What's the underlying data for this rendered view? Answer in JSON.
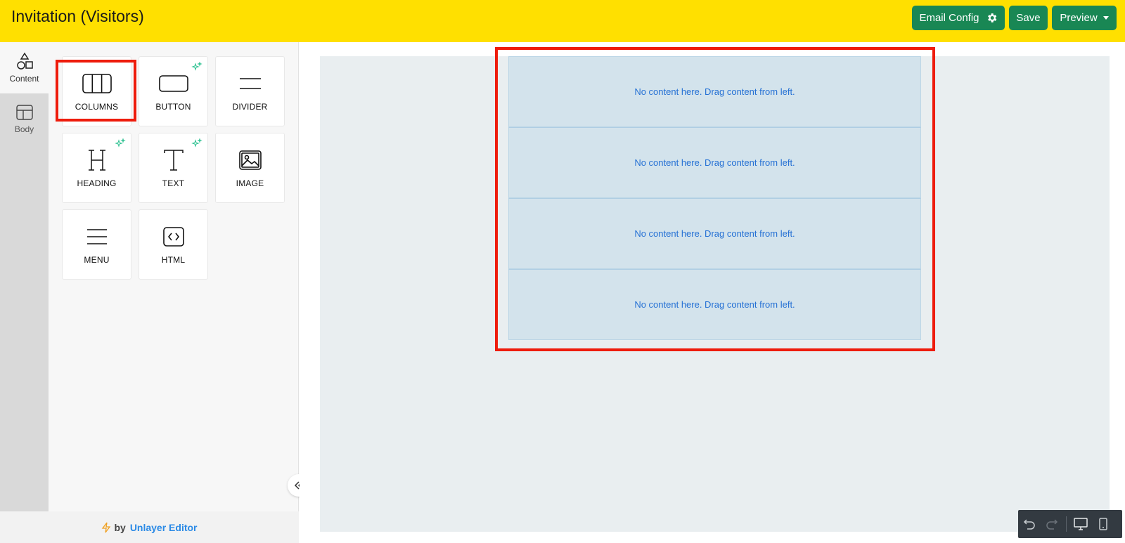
{
  "header": {
    "title": "Invitation (Visitors)",
    "email_config_label": "Email Config",
    "save_label": "Save",
    "preview_label": "Preview"
  },
  "tabs": [
    {
      "label": "Content",
      "icon": "shapes-icon"
    },
    {
      "label": "Body",
      "icon": "layout-icon"
    }
  ],
  "tools": [
    {
      "label": "COLUMNS",
      "icon": "columns-icon",
      "ai": false
    },
    {
      "label": "BUTTON",
      "icon": "button-icon",
      "ai": true
    },
    {
      "label": "DIVIDER",
      "icon": "divider-icon",
      "ai": false
    },
    {
      "label": "HEADING",
      "icon": "heading-icon",
      "ai": true
    },
    {
      "label": "TEXT",
      "icon": "text-icon",
      "ai": true
    },
    {
      "label": "IMAGE",
      "icon": "image-icon",
      "ai": false
    },
    {
      "label": "MENU",
      "icon": "menu-icon",
      "ai": false
    },
    {
      "label": "HTML",
      "icon": "code-icon",
      "ai": false
    }
  ],
  "canvas": {
    "rows": [
      "No content here. Drag content from left.",
      "No content here. Drag content from left.",
      "No content here. Drag content from left.",
      "No content here. Drag content from left."
    ]
  },
  "footer": {
    "by_label": "by",
    "brand_label": "Unlayer Editor"
  },
  "colors": {
    "header_bg": "#ffe000",
    "button_green": "#198754",
    "highlight_red": "#ee1c0c",
    "empty_row_text": "#2470d4"
  }
}
